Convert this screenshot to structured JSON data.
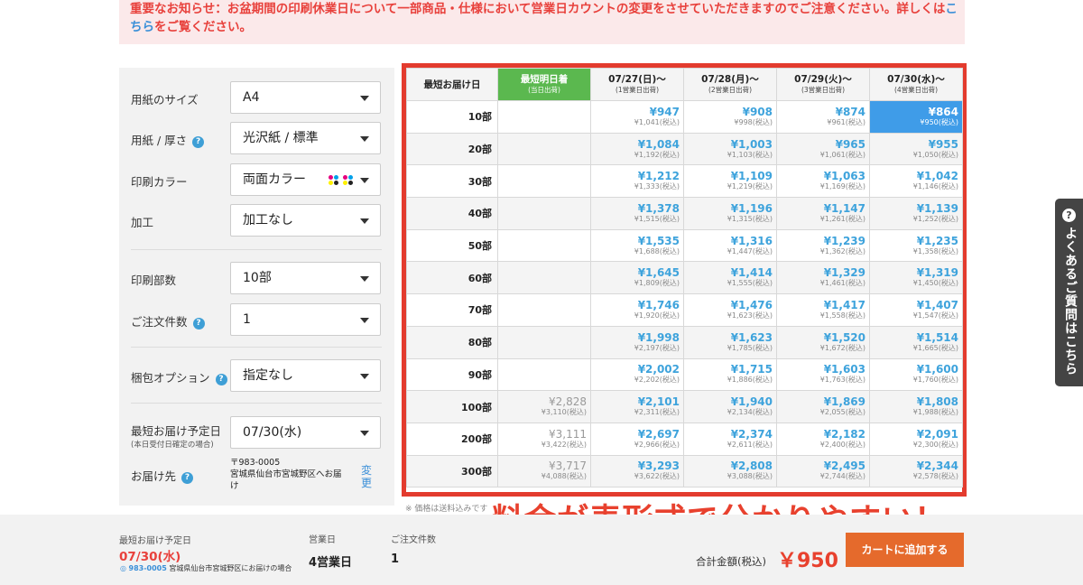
{
  "notice": {
    "text": "重要なお知らせ：お盆期間の印刷休業日について一部商品・仕様において営業日カウントの変更をさせていただきますのでご注意ください。詳しくは",
    "link": "こちら",
    "tail": "をご覧ください。"
  },
  "options": {
    "paper_size": {
      "label": "用紙のサイズ",
      "value": "A4"
    },
    "paper_type": {
      "label": "用紙 / 厚さ",
      "value": "光沢紙 / 標準"
    },
    "print_color": {
      "label": "印刷カラー",
      "value": "両面カラー"
    },
    "processing": {
      "label": "加工",
      "value": "加工なし"
    },
    "print_qty": {
      "label": "印刷部数",
      "value": "10部"
    },
    "order_count": {
      "label": "ご注文件数",
      "value": "1"
    },
    "packing": {
      "label": "梱包オプション",
      "value": "指定なし"
    },
    "delivery_date": {
      "label": "最短お届け予定日",
      "sublabel": "(本日受付日確定の場合)",
      "value": "07/30(水)"
    },
    "destination": {
      "label": "お届け先",
      "zip": "〒983-0005",
      "address": "宮城県仙台市宮城野区へお届け",
      "change": "変更"
    }
  },
  "table": {
    "corner": "最短お届け日",
    "columns": [
      {
        "title": "最短明日着",
        "sub": "(当日出荷)"
      },
      {
        "title": "07/27(日)〜",
        "sub": "(1営業日出荷)"
      },
      {
        "title": "07/28(月)〜",
        "sub": "(2営業日出荷)"
      },
      {
        "title": "07/29(火)〜",
        "sub": "(3営業日出荷)"
      },
      {
        "title": "07/30(水)〜",
        "sub": "(4営業日出荷)"
      }
    ],
    "rows": [
      {
        "qty": "10部",
        "cells": [
          null,
          [
            "¥947",
            "¥1,041(税込)"
          ],
          [
            "¥908",
            "¥998(税込)"
          ],
          [
            "¥874",
            "¥961(税込)"
          ],
          [
            "¥864",
            "¥950(税込)"
          ]
        ]
      },
      {
        "qty": "20部",
        "cells": [
          null,
          [
            "¥1,084",
            "¥1,192(税込)"
          ],
          [
            "¥1,003",
            "¥1,103(税込)"
          ],
          [
            "¥965",
            "¥1,061(税込)"
          ],
          [
            "¥955",
            "¥1,050(税込)"
          ]
        ]
      },
      {
        "qty": "30部",
        "cells": [
          null,
          [
            "¥1,212",
            "¥1,333(税込)"
          ],
          [
            "¥1,109",
            "¥1,219(税込)"
          ],
          [
            "¥1,063",
            "¥1,169(税込)"
          ],
          [
            "¥1,042",
            "¥1,146(税込)"
          ]
        ]
      },
      {
        "qty": "40部",
        "cells": [
          null,
          [
            "¥1,378",
            "¥1,515(税込)"
          ],
          [
            "¥1,196",
            "¥1,315(税込)"
          ],
          [
            "¥1,147",
            "¥1,261(税込)"
          ],
          [
            "¥1,139",
            "¥1,252(税込)"
          ]
        ]
      },
      {
        "qty": "50部",
        "cells": [
          null,
          [
            "¥1,535",
            "¥1,688(税込)"
          ],
          [
            "¥1,316",
            "¥1,447(税込)"
          ],
          [
            "¥1,239",
            "¥1,362(税込)"
          ],
          [
            "¥1,235",
            "¥1,358(税込)"
          ]
        ]
      },
      {
        "qty": "60部",
        "cells": [
          null,
          [
            "¥1,645",
            "¥1,809(税込)"
          ],
          [
            "¥1,414",
            "¥1,555(税込)"
          ],
          [
            "¥1,329",
            "¥1,461(税込)"
          ],
          [
            "¥1,319",
            "¥1,450(税込)"
          ]
        ]
      },
      {
        "qty": "70部",
        "cells": [
          null,
          [
            "¥1,746",
            "¥1,920(税込)"
          ],
          [
            "¥1,476",
            "¥1,623(税込)"
          ],
          [
            "¥1,417",
            "¥1,558(税込)"
          ],
          [
            "¥1,407",
            "¥1,547(税込)"
          ]
        ]
      },
      {
        "qty": "80部",
        "cells": [
          null,
          [
            "¥1,998",
            "¥2,197(税込)"
          ],
          [
            "¥1,623",
            "¥1,785(税込)"
          ],
          [
            "¥1,520",
            "¥1,672(税込)"
          ],
          [
            "¥1,514",
            "¥1,665(税込)"
          ]
        ]
      },
      {
        "qty": "90部",
        "cells": [
          null,
          [
            "¥2,002",
            "¥2,202(税込)"
          ],
          [
            "¥1,715",
            "¥1,886(税込)"
          ],
          [
            "¥1,603",
            "¥1,763(税込)"
          ],
          [
            "¥1,600",
            "¥1,760(税込)"
          ]
        ]
      },
      {
        "qty": "100部",
        "cells": [
          [
            "¥2,828",
            "¥3,110(税込)"
          ],
          [
            "¥2,101",
            "¥2,311(税込)"
          ],
          [
            "¥1,940",
            "¥2,134(税込)"
          ],
          [
            "¥1,869",
            "¥2,055(税込)"
          ],
          [
            "¥1,808",
            "¥1,988(税込)"
          ]
        ]
      },
      {
        "qty": "200部",
        "cells": [
          [
            "¥3,111",
            "¥3,422(税込)"
          ],
          [
            "¥2,697",
            "¥2,966(税込)"
          ],
          [
            "¥2,374",
            "¥2,611(税込)"
          ],
          [
            "¥2,182",
            "¥2,400(税込)"
          ],
          [
            "¥2,091",
            "¥2,300(税込)"
          ]
        ]
      },
      {
        "qty": "300部",
        "cells": [
          [
            "¥3,717",
            "¥4,088(税込)"
          ],
          [
            "¥3,293",
            "¥3,622(税込)"
          ],
          [
            "¥2,808",
            "¥3,088(税込)"
          ],
          [
            "¥2,495",
            "¥2,744(税込)"
          ],
          [
            "¥2,344",
            "¥2,578(税込)"
          ]
        ]
      }
    ],
    "note": "※ 価格は送料込みです"
  },
  "overlay_text": "料金が表形式で分かりやすい！",
  "footer": {
    "delivery_label": "最短お届け予定日",
    "delivery_value": "07/30(水)",
    "zip": "983-0005",
    "address": "宮城県仙台市宮城野区にお届けの場合",
    "business_days_label": "営業日",
    "business_days_value": "4営業日",
    "order_count_label": "ご注文件数",
    "order_count_value": "1",
    "total_label": "合計金額(税込)",
    "total_value": "￥950",
    "cart_button": "カートに追加する"
  },
  "faq_tab": "よくあるご質問はこちら",
  "colors": {
    "accent_red": "#e8412e",
    "price_blue": "#3ea3dc",
    "highlight_green": "#5bb84f",
    "selected_blue": "#3f9ce8",
    "cart_orange": "#e56a2c"
  }
}
